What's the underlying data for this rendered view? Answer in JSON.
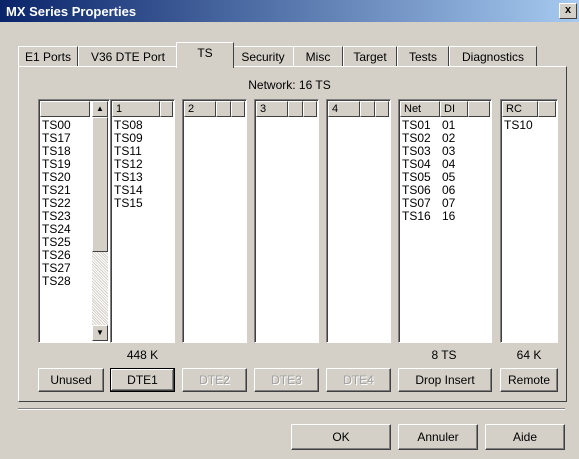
{
  "window": {
    "title": "MX Series Properties",
    "close_glyph": "x"
  },
  "tabs": [
    {
      "label": "E1 Ports"
    },
    {
      "label": "V36 DTE Port"
    },
    {
      "label": "TS"
    },
    {
      "label": "Security"
    },
    {
      "label": "Misc"
    },
    {
      "label": "Target"
    },
    {
      "label": "Tests"
    },
    {
      "label": "Diagnostics"
    }
  ],
  "active_tab": "TS",
  "network_label": "Network: 16 TS",
  "unused_list": {
    "items": [
      "TS00",
      "TS17",
      "TS18",
      "TS19",
      "TS20",
      "TS21",
      "TS22",
      "TS23",
      "TS24",
      "TS25",
      "TS26",
      "TS27",
      "TS28"
    ]
  },
  "dte1_list": {
    "header": "1",
    "items": [
      "TS08",
      "TS09",
      "TS11",
      "TS12",
      "TS13",
      "TS14",
      "TS15"
    ]
  },
  "dte2_list": {
    "header": "2",
    "items": []
  },
  "dte3_list": {
    "header": "3",
    "items": []
  },
  "dte4_list": {
    "header": "4",
    "items": []
  },
  "net_list": {
    "header_net": "Net",
    "header_dl": "DI",
    "rows": [
      {
        "net": "TS01",
        "dl": "01"
      },
      {
        "net": "TS02",
        "dl": "02"
      },
      {
        "net": "TS03",
        "dl": "03"
      },
      {
        "net": "TS04",
        "dl": "04"
      },
      {
        "net": "TS05",
        "dl": "05"
      },
      {
        "net": "TS06",
        "dl": "06"
      },
      {
        "net": "TS07",
        "dl": "07"
      },
      {
        "net": "TS16",
        "dl": "16"
      }
    ]
  },
  "rc_list": {
    "header": "RC",
    "items": [
      "TS10"
    ]
  },
  "captions": {
    "dte1": "448 K",
    "net": "8 TS",
    "rc": "64 K"
  },
  "buttons": {
    "unused": "Unused",
    "dte1": "DTE1",
    "dte2": "DTE2",
    "dte3": "DTE3",
    "dte4": "DTE4",
    "drop_insert": "Drop Insert",
    "remote": "Remote"
  },
  "footer": {
    "ok": "OK",
    "cancel": "Annuler",
    "help": "Aide"
  }
}
